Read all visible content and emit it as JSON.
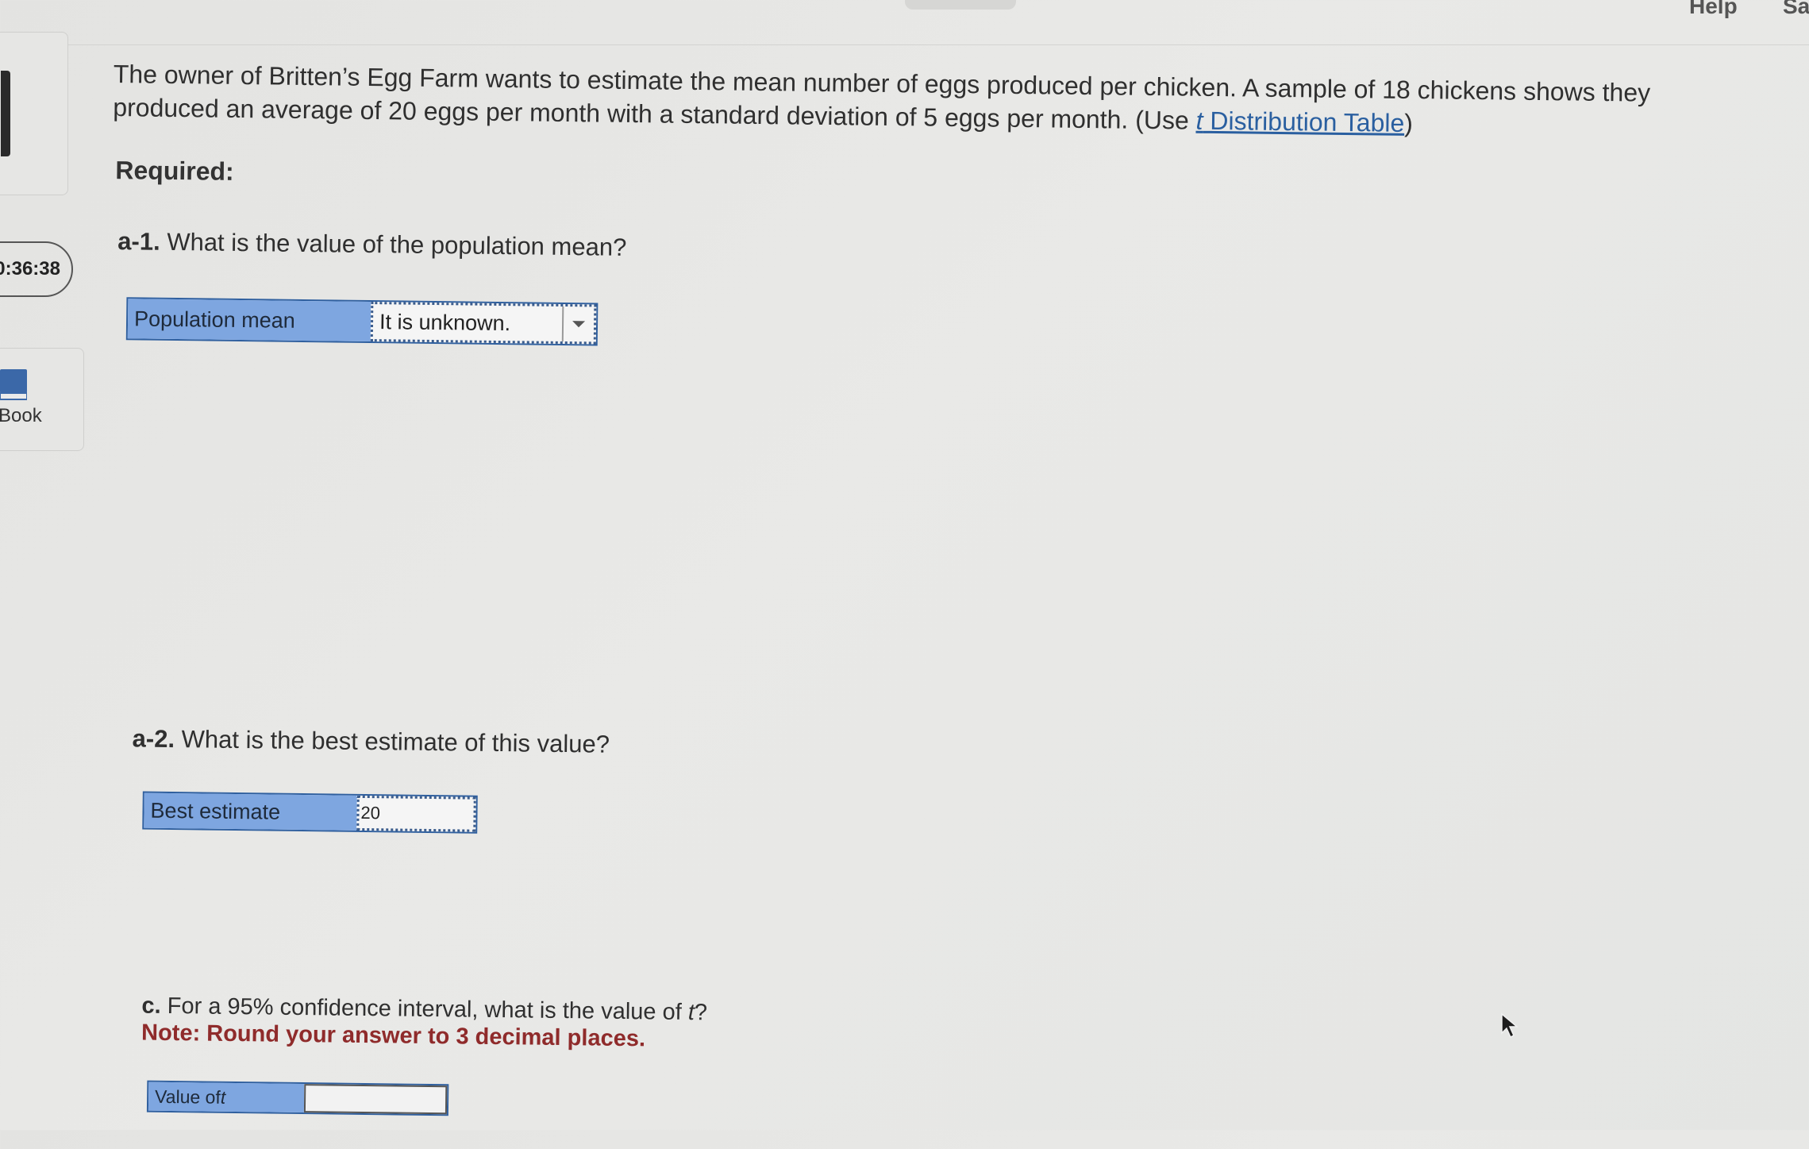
{
  "header": {
    "help_label": "Help",
    "save_label": "Sa"
  },
  "sidebar": {
    "timer": "0:36:38",
    "book_label": "Book"
  },
  "problem": {
    "intro_text": "The owner of Britten’s Egg Farm wants to estimate the mean number of eggs produced per chicken. A sample of 18 chickens shows they produced an average of 20 eggs per month with a standard deviation of 5 eggs per month. (Use ",
    "link_t": "t",
    "link_text": " Distribution Table",
    "intro_close": ")",
    "required_label": "Required:"
  },
  "questions": {
    "a1": {
      "number": "a-1.",
      "text": " What is the value of the population mean?",
      "label": "Population mean",
      "selected": "It is unknown."
    },
    "a2": {
      "number": "a-2.",
      "text": " What is the best estimate of this value?",
      "label": "Best estimate",
      "value": "20"
    },
    "c": {
      "number": "c.",
      "text": " For a 95% confidence interval, what is the value of ",
      "t": "t",
      "end": "?",
      "note": "Note: Round your answer to 3 decimal places.",
      "label_prefix": "Value of ",
      "label_t": "t",
      "value": ""
    }
  },
  "icons": {
    "dropdown": "chevron-down-icon",
    "book": "book-icon",
    "cursor": "mouse-cursor-icon"
  },
  "colors": {
    "label_fill": "#7ea6e0",
    "label_border": "#2f5f9e",
    "link": "#2a5fa0",
    "note": "#8f2b2b"
  }
}
